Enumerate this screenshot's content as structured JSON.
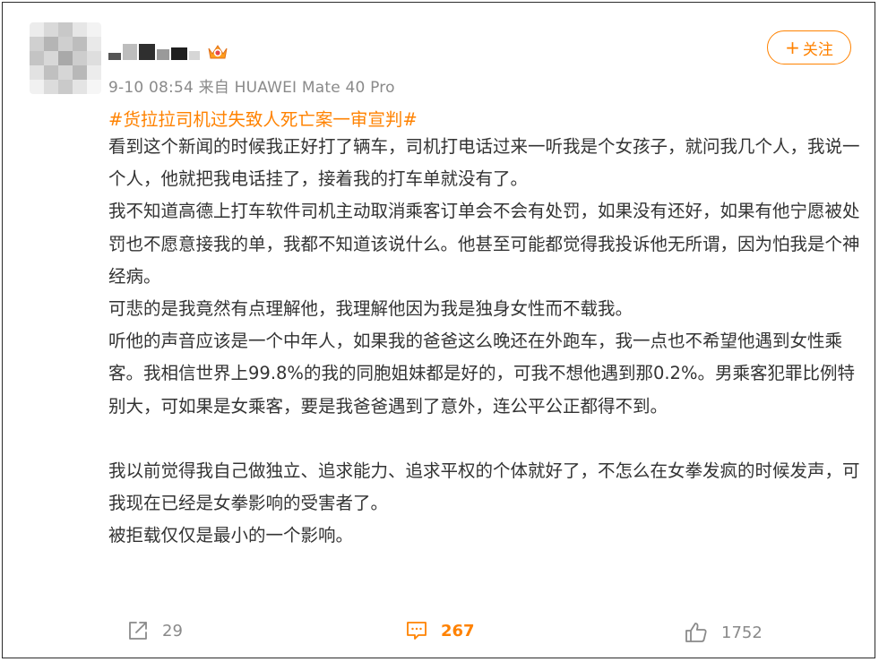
{
  "post": {
    "user": {
      "avatar": "blurred-avatar",
      "username": "",
      "badge_icon": "vip-crown-icon"
    },
    "meta": "9-10 08:54  来自 HUAWEI Mate 40 Pro",
    "follow_label": "关注",
    "follow_icon": "plus-icon",
    "hashtag": "#货拉拉司机过失致人死亡案一审宣判#",
    "paragraphs": [
      "看到这个新闻的时候我正好打了辆车，司机打电话过来一听我是个女孩子，就问我几个人，我说一个人，他就把我电话挂了，接着我的打车单就没有了。",
      "我不知道高德上打车软件司机主动取消乘客订单会不会有处罚，如果没有还好，如果有他宁愿被处罚也不愿意接我的单，我都不知道该说什么。他甚至可能都觉得我投诉他无所谓，因为怕我是个神经病。",
      "可悲的是我竟然有点理解他，我理解他因为我是独身女性而不载我。",
      "听他的声音应该是一个中年人，如果我的爸爸这么晚还在外跑车，我一点也不希望他遇到女性乘客。我相信世界上99.8%的我的同胞姐妹都是好的，可我不想他遇到那0.2%。男乘客犯罪比例特别大，可如果是女乘客，要是我爸爸遇到了意外，连公平公正都得不到。",
      "我以前觉得我自己做独立、追求能力、追求平权的个体就好了，不怎么在女拳发疯的时候发声，可我现在已经是女拳影响的受害者了。",
      "被拒载仅仅是最小的一个影响。"
    ],
    "actions": {
      "repost": {
        "icon": "share-icon",
        "count": "29"
      },
      "comment": {
        "icon": "comment-icon",
        "count": "267"
      },
      "like": {
        "icon": "thumbs-up-icon",
        "count": "1752"
      }
    },
    "colors": {
      "accent": "#ff8200",
      "text": "#333333",
      "meta": "#8a8a8a"
    }
  }
}
